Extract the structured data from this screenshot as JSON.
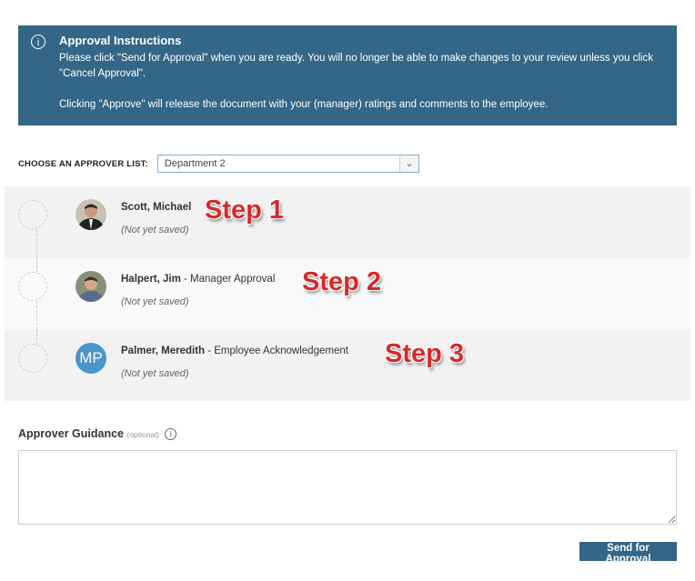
{
  "banner": {
    "title": "Approval Instructions",
    "p1": "Please click \"Send for Approval\" when you are ready. You will no longer be able to make changes to your review unless you click \"Cancel Approval\".",
    "p2": "Clicking \"Approve\" will release the document with your (manager) ratings and comments to the employee.",
    "icon": "info-icon"
  },
  "chooser": {
    "label": "CHOOSE AN APPROVER LIST:",
    "value": "Department 2"
  },
  "approvers": [
    {
      "name": "Scott, Michael",
      "role": "",
      "status": "(Not yet saved)",
      "step": "Step 1"
    },
    {
      "name": "Halpert, Jim",
      "role": " - Manager Approval",
      "status": "(Not yet saved)",
      "step": "Step 2"
    },
    {
      "name": "Palmer, Meredith",
      "role": " - Employee Acknowledgement",
      "status": "(Not yet saved)",
      "step": "Step 3",
      "initials": "MP"
    }
  ],
  "guidance": {
    "label": "Approver Guidance",
    "optional": "(optional)",
    "value": ""
  },
  "send_label": "Send for Approval",
  "colors": {
    "accent": "#336687",
    "avatar": "#4a95c9",
    "step": "#d42a2a"
  }
}
